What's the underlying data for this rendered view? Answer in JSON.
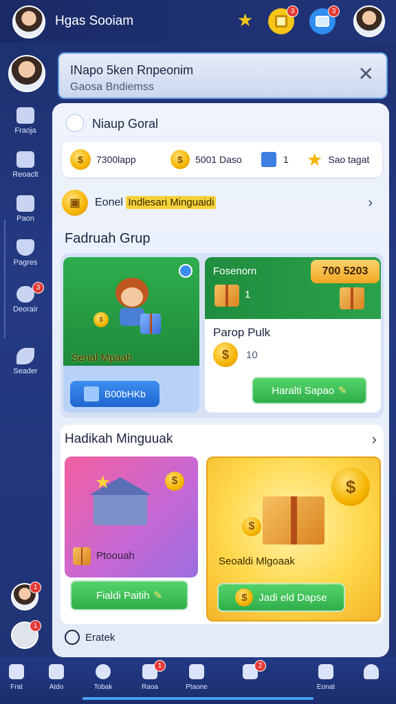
{
  "topbar": {
    "title": "Hgas Sooiam",
    "badge_a": "3",
    "badge_b": "3"
  },
  "rail": {
    "items": [
      {
        "label": "Fraoja"
      },
      {
        "label": "Reoaclt"
      },
      {
        "label": "Paon"
      },
      {
        "label": "Pagres"
      },
      {
        "label": "Deorair",
        "badge": "3"
      },
      {
        "label": "Seader"
      }
    ],
    "bottom_badges": [
      "1",
      "1"
    ]
  },
  "header": {
    "title": "INapo 5ken Rnpeonim",
    "subtitle": "Gaosa Bndiemss"
  },
  "panel": {
    "title": "Niaup Goral"
  },
  "stats": [
    {
      "label": "7300lapp",
      "icon": "coin-icon"
    },
    {
      "label": "5001 Daso",
      "icon": "coin-icon"
    },
    {
      "label": "1",
      "icon": "card-icon"
    },
    {
      "label": "Sao tagat",
      "icon": "star-icon"
    }
  ],
  "promo": {
    "prefix": "Eonel",
    "highlight": "Indlesari Minguaidi"
  },
  "group": {
    "title": "Fadruah Grup",
    "left_card": {
      "label": "Senal Mpaah",
      "button": "B00bHKb"
    },
    "right_card": {
      "header": "Fosenorn",
      "price": "700 5203",
      "count": "1",
      "subtitle": "Parop Pulk",
      "coins": "10",
      "button": "Haralti Sapao"
    }
  },
  "gifts": {
    "title": "Hadikah Minguuak",
    "left_card": {
      "label": "Ptoouah",
      "button": "Fialdi Paitih"
    },
    "right_card": {
      "label": "Seoaldi Mlgoaak",
      "button": "Jadi eld Dapse"
    }
  },
  "footer": {
    "label": "Eratek"
  },
  "bottom_nav": [
    {
      "label": "Frat"
    },
    {
      "label": "Atdo"
    },
    {
      "label": "Tobak"
    },
    {
      "label": "Raoa",
      "badge": "1"
    },
    {
      "label": "Ptaone"
    },
    {
      "label": "",
      "badge": "2"
    },
    {
      "label": "Eonat"
    },
    {
      "label": ""
    }
  ],
  "colors": {
    "accent": "#2fae4a",
    "nav_bg": "#1d2f6e",
    "gold": "#f5b400",
    "badge": "#e53935"
  }
}
